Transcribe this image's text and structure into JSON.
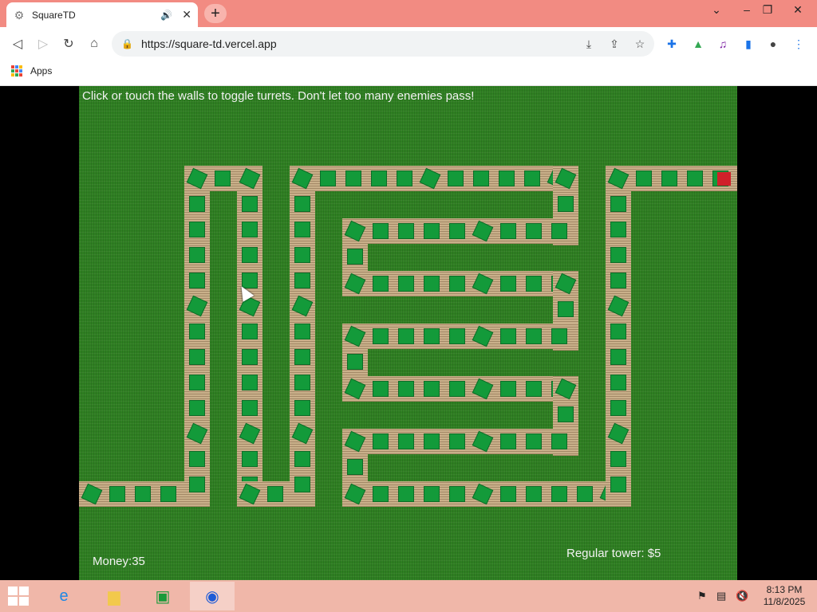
{
  "browser": {
    "tab_title": "SquareTD",
    "tab_favicon": "gear-icon",
    "url": "https://square-td.vercel.app",
    "bookmarks_apps_label": "Apps"
  },
  "game": {
    "instructions": "Click or touch the walls to toggle turrets. Don't let too many enemies pass!",
    "money_label": "Money:35",
    "tower_price_label": "Regular tower: $5",
    "colors": {
      "grass": "#2f7f22",
      "path": "#c9b08a",
      "turret": "#139a3a",
      "goal": "#d0202a",
      "text": "#f2f2f2"
    }
  },
  "taskbar": {
    "time": "8:13 PM",
    "date": "11/8/2025",
    "apps": [
      "internet-explorer-icon",
      "file-explorer-icon",
      "store-icon",
      "chrome-icon"
    ]
  }
}
